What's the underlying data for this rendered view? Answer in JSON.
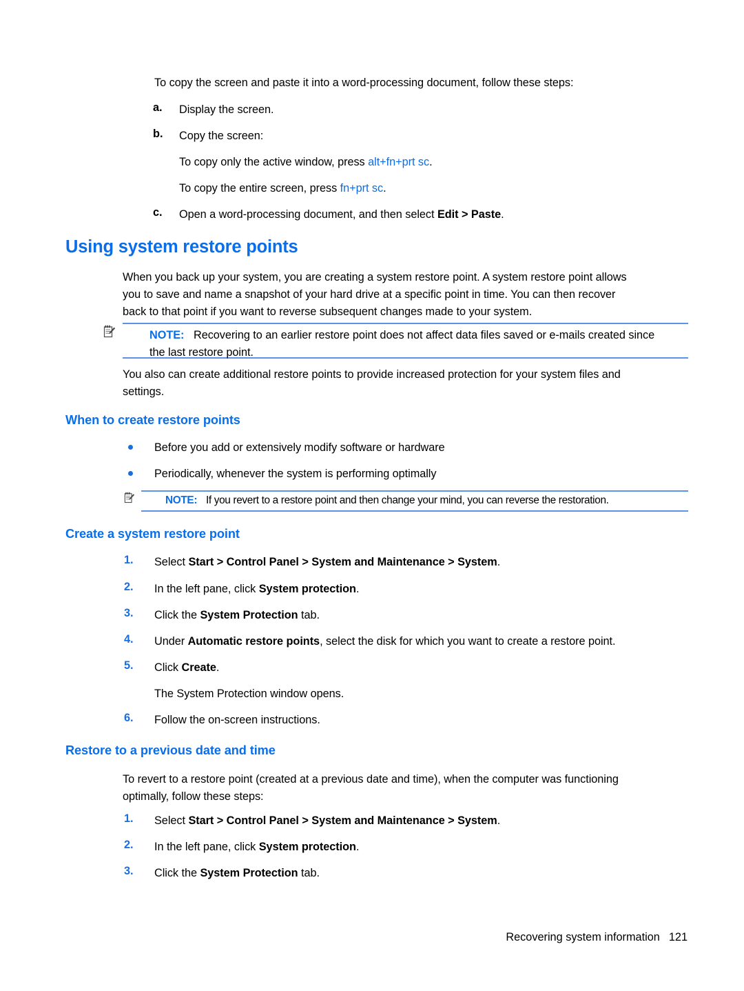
{
  "document": {
    "intro_paragraph": "To copy the screen and paste it into a word-processing document, follow these steps:",
    "alpha_steps": [
      {
        "marker": "a.",
        "text": "Display the screen."
      },
      {
        "marker": "b.",
        "text": "Copy the screen:"
      },
      {
        "marker": "c.",
        "text_before": "Open a word-processing document, and then select ",
        "bold": "Edit > Paste",
        "text_after": "."
      }
    ],
    "shortcut_lines": [
      {
        "prefix": "To copy only the active window, press ",
        "keys": "alt+fn+prt sc",
        "suffix": "."
      },
      {
        "prefix": "To copy the entire screen, press ",
        "keys": "fn+prt sc",
        "suffix": "."
      }
    ],
    "section_heading": "Using system restore points",
    "section_paragraph_lines": [
      "When you back up your system, you are creating a system restore point. A system restore point allows",
      "you to save and name a snapshot of your hard drive at a specific point in time. You can then recover",
      "back to that point if you want to reverse subsequent changes made to your system."
    ],
    "note_1": {
      "icon": "note-pad-pencil-icon",
      "label": "NOTE:",
      "lines": [
        "Recovering to an earlier restore point does not affect data files saved or e-mails created since",
        "the last restore point."
      ]
    },
    "paragraph_after_note_lines": [
      "You also can create additional restore points to provide increased protection for your system files and",
      "settings."
    ],
    "subheading_when": "When to create restore points",
    "bullets": [
      "Before you add or extensively modify software or hardware",
      "Periodically, whenever the system is performing optimally"
    ],
    "note_2": {
      "icon": "note-pad-pencil-icon",
      "label": "NOTE:",
      "lines": [
        "If you revert to a restore point and then change your mind, you can reverse the restoration."
      ]
    },
    "subheading_create": "Create a system restore point",
    "create_steps": [
      {
        "marker": "1.",
        "parts": [
          {
            "t": "Select ",
            "b": false
          },
          {
            "t": "Start > Control Panel > System and Maintenance > System",
            "b": true
          },
          {
            "t": ".",
            "b": false
          }
        ]
      },
      {
        "marker": "2.",
        "parts": [
          {
            "t": "In the left pane, click ",
            "b": false
          },
          {
            "t": "System protection",
            "b": true
          },
          {
            "t": ".",
            "b": false
          }
        ]
      },
      {
        "marker": "3.",
        "parts": [
          {
            "t": "Click the ",
            "b": false
          },
          {
            "t": "System Protection",
            "b": true
          },
          {
            "t": " tab.",
            "b": false
          }
        ]
      },
      {
        "marker": "4.",
        "parts": [
          {
            "t": "Under ",
            "b": false
          },
          {
            "t": "Automatic restore points",
            "b": true
          },
          {
            "t": ", select the disk for which you want to create a restore point.",
            "b": false
          }
        ]
      },
      {
        "marker": "5.",
        "parts": [
          {
            "t": "Click ",
            "b": false
          },
          {
            "t": "Create",
            "b": true
          },
          {
            "t": ".",
            "b": false
          }
        ]
      },
      {
        "marker": "6.",
        "parts": [
          {
            "t": "Follow the on-screen instructions.",
            "b": false
          }
        ]
      }
    ],
    "create_step5_note": "The System Protection window opens.",
    "subheading_restore": "Restore to a previous date and time",
    "restore_intro_lines": [
      "To revert to a restore point (created at a previous date and time), when the computer was functioning",
      "optimally, follow these steps:"
    ],
    "restore_steps": [
      {
        "marker": "1.",
        "parts": [
          {
            "t": "Select ",
            "b": false
          },
          {
            "t": "Start > Control Panel > System and Maintenance > System",
            "b": true
          },
          {
            "t": ".",
            "b": false
          }
        ]
      },
      {
        "marker": "2.",
        "parts": [
          {
            "t": "In the left pane, click ",
            "b": false
          },
          {
            "t": "System protection",
            "b": true
          },
          {
            "t": ".",
            "b": false
          }
        ]
      },
      {
        "marker": "3.",
        "parts": [
          {
            "t": "Click the ",
            "b": false
          },
          {
            "t": "System Protection",
            "b": true
          },
          {
            "t": " tab.",
            "b": false
          }
        ]
      }
    ],
    "footer": {
      "title": "Recovering system information",
      "page_number": "121"
    },
    "colors": {
      "heading_blue": "#0a6ee8",
      "rule_blue": "#5b92e8",
      "marker_blue": "#1a6fe0",
      "text_black": "#000000"
    }
  }
}
